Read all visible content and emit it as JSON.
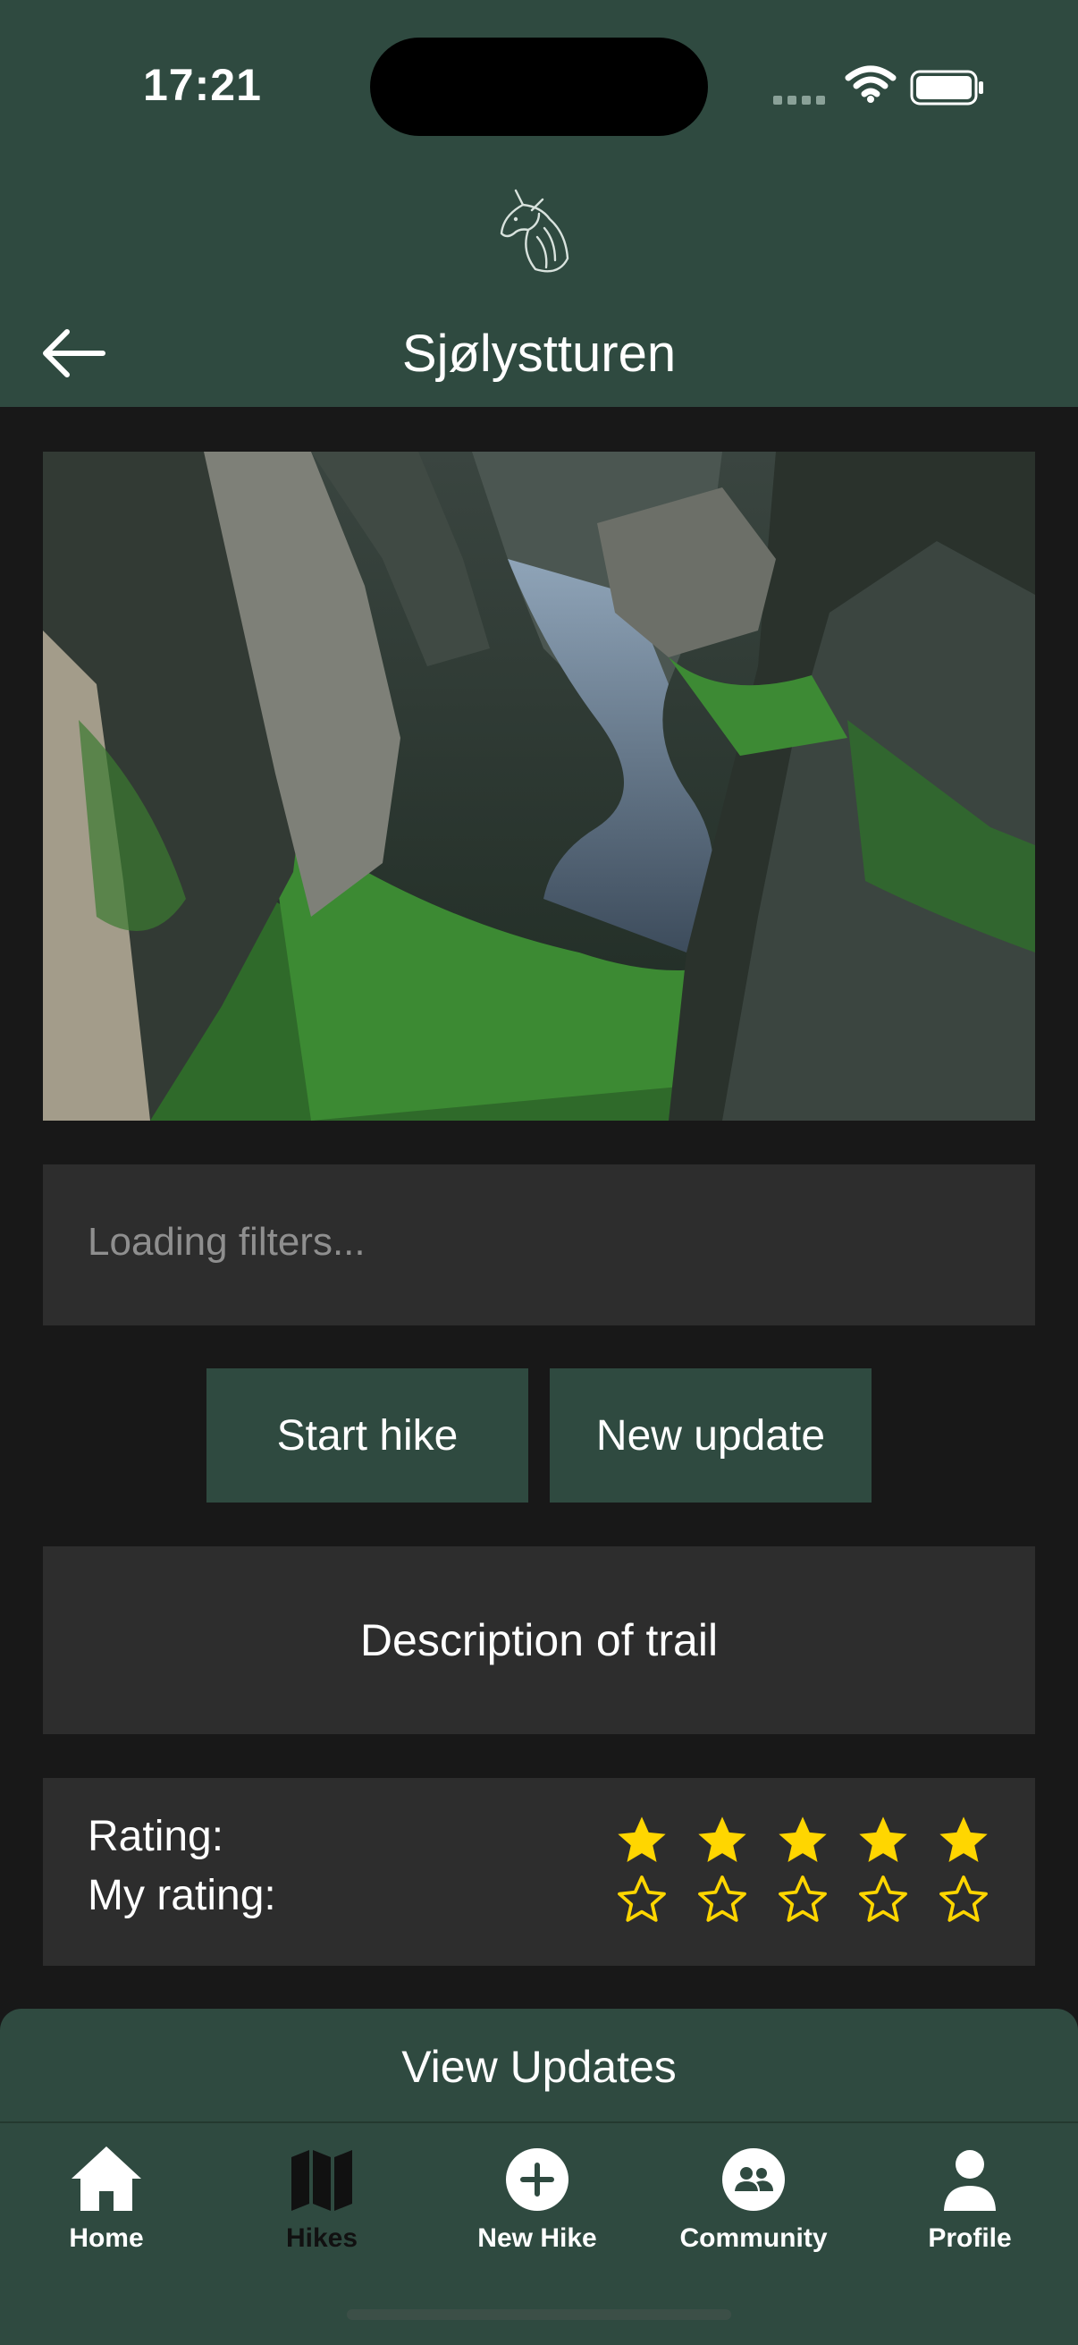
{
  "status": {
    "time": "17:21"
  },
  "header": {
    "title": "Sjølystturen"
  },
  "filters": {
    "text": "Loading filters..."
  },
  "actions": {
    "start_label": "Start hike",
    "update_label": "New update"
  },
  "description": {
    "label": "Description of trail"
  },
  "rating": {
    "rating_label": "Rating:",
    "my_rating_label": "My rating:",
    "rating_value": 5,
    "my_rating_value": 0,
    "max": 5,
    "star_color": "#FFD600"
  },
  "updates": {
    "label": "View Updates"
  },
  "tabs": [
    {
      "label": "Home",
      "icon": "home-icon",
      "active": true
    },
    {
      "label": "Hikes",
      "icon": "map-icon",
      "active": false
    },
    {
      "label": "New Hike",
      "icon": "plus-circle-icon",
      "active": true
    },
    {
      "label": "Community",
      "icon": "community-icon",
      "active": true
    },
    {
      "label": "Profile",
      "icon": "person-icon",
      "active": true
    }
  ],
  "colors": {
    "header": "#2f4a40",
    "background": "#181818",
    "card": "#2d2d2d",
    "accent_star": "#FFD600"
  }
}
